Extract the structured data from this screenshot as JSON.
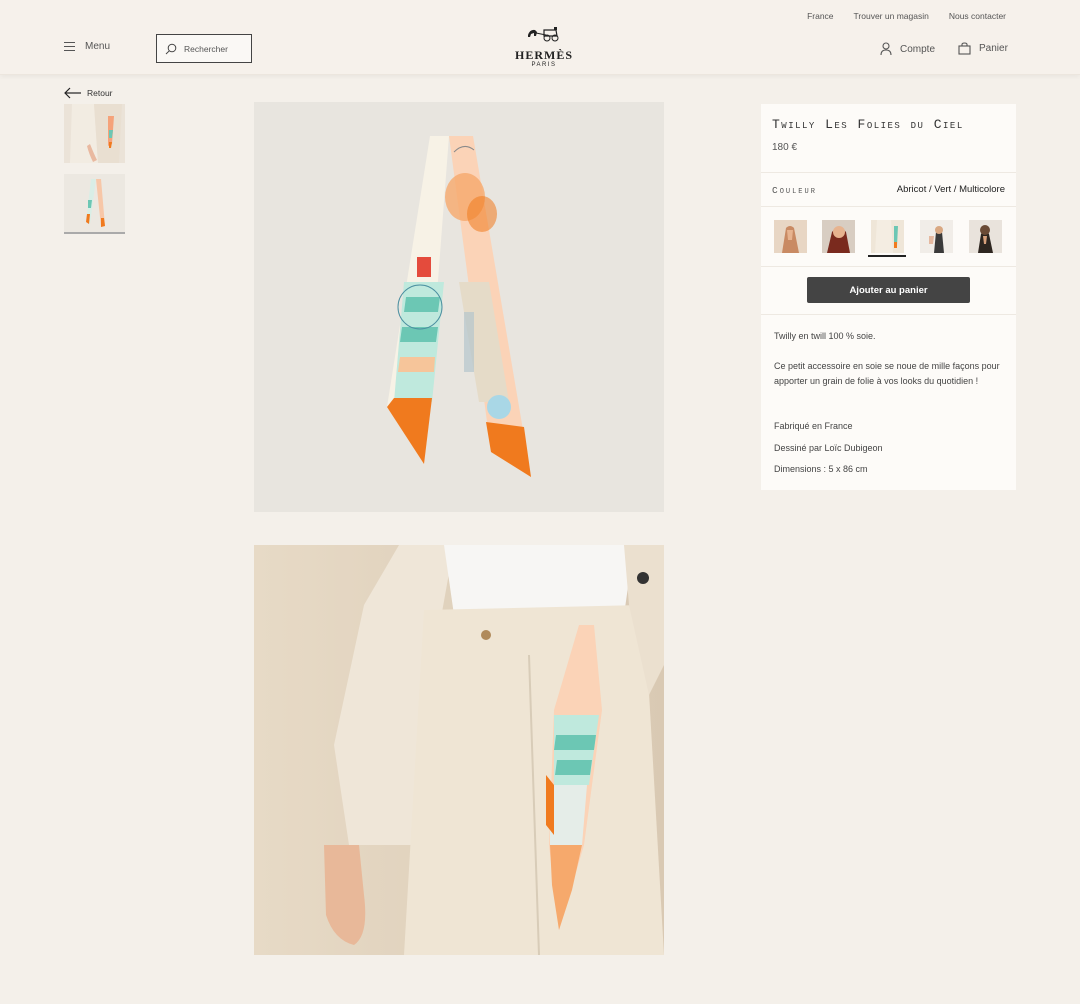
{
  "header": {
    "top_links": [
      "France",
      "Trouver un magasin",
      "Nous contacter"
    ],
    "menu_label": "Menu",
    "search_placeholder": "Rechercher",
    "logo": {
      "wordmark": "HERMÈS",
      "city": "PARIS"
    },
    "account_label": "Compte",
    "cart_label": "Panier"
  },
  "back_label": "Retour",
  "product": {
    "title": "Twilly Les Folies du Ciel",
    "price": "180 €",
    "color_label": "Couleur",
    "color_value": "Abricot / Vert / Multicolore",
    "add_to_cart": "Ajouter au panier",
    "description": [
      "Twilly en twill 100 % soie.",
      "Ce petit accessoire en soie se noue de mille façons pour apporter un grain de folie à vos looks du quotidien !",
      "Fabriqué en France",
      "Dessiné par Loïc Dubigeon",
      "Dimensions : 5 x 86 cm"
    ]
  },
  "colors": {
    "accent": "#444444",
    "background": "#f4f0ea",
    "scarf_orange": "#f07a1e"
  }
}
